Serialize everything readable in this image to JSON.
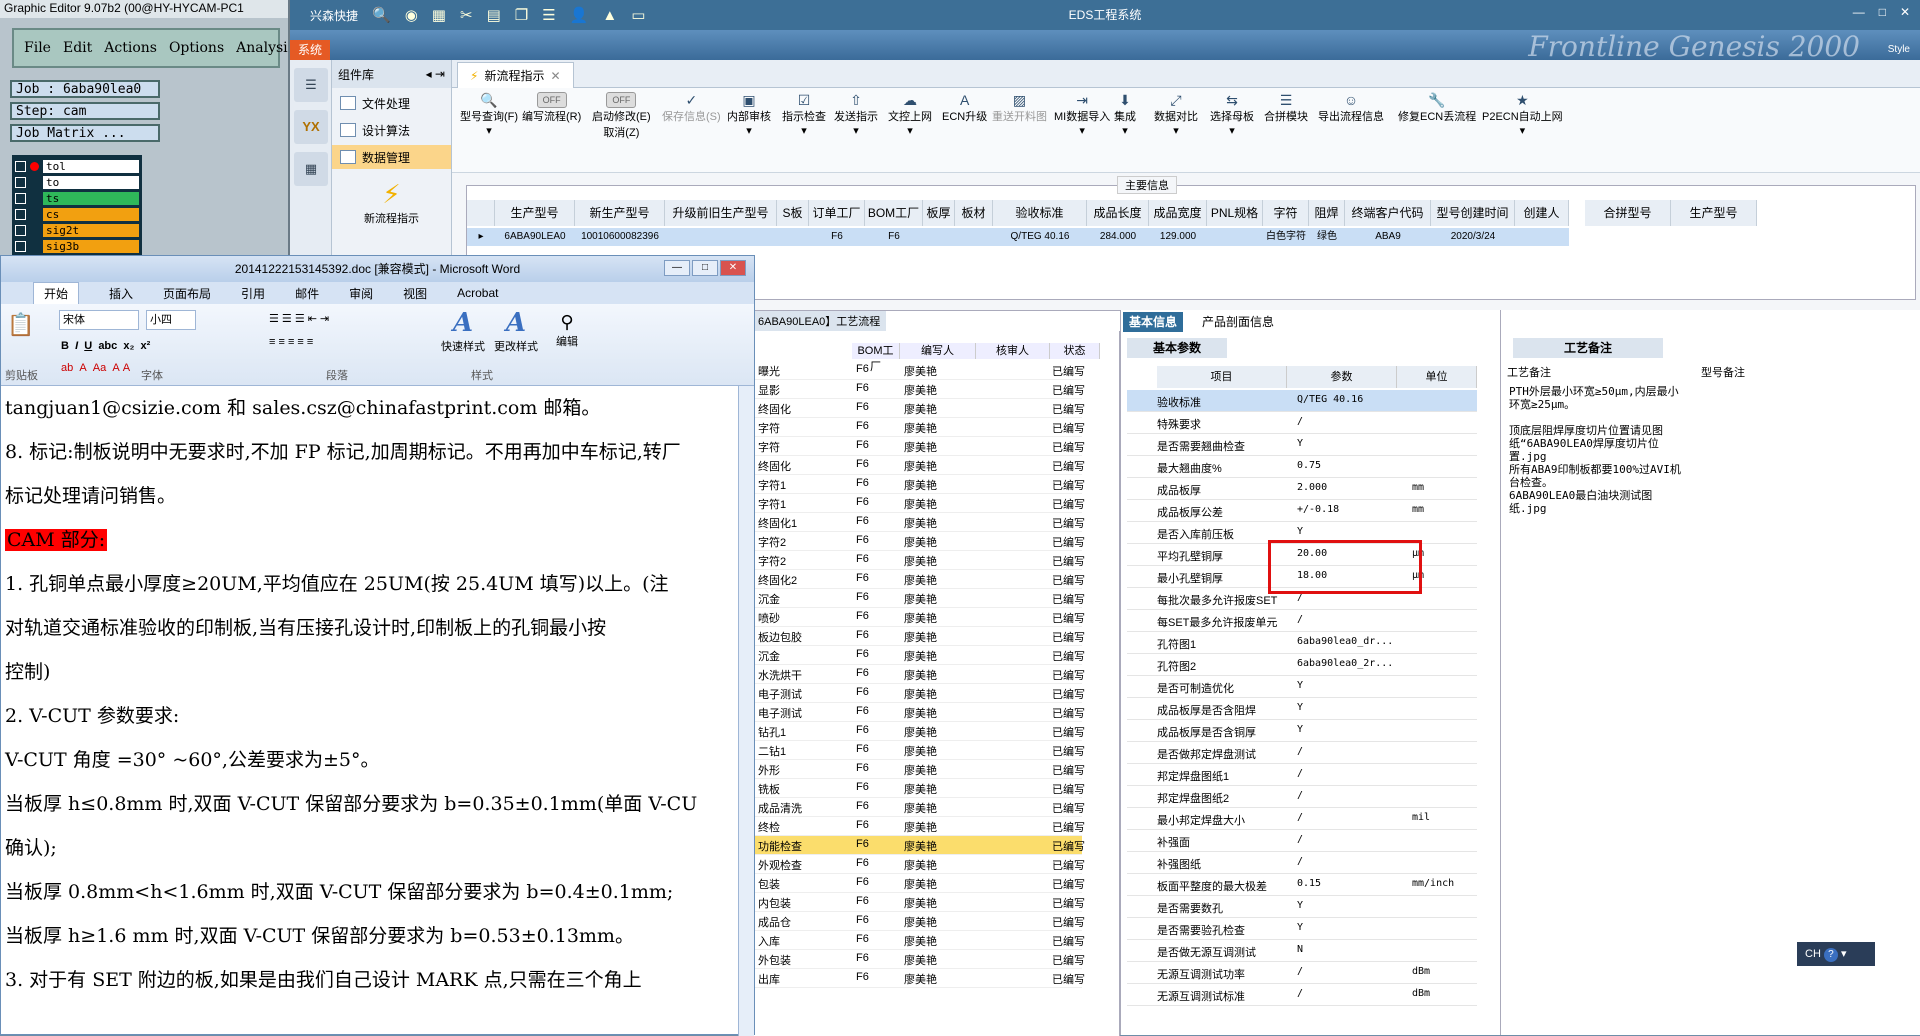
{
  "ge": {
    "title": "Graphic Editor 9.07b2 (00@HY-HYCAM-PC1",
    "menu": [
      "File",
      "Edit",
      "Actions",
      "Options",
      "Analysi"
    ],
    "job": "Job : 6aba90lea0",
    "step": "Step: cam",
    "matrix": "Job Matrix ...",
    "layers": [
      "tol",
      "to",
      "ts",
      "cs",
      "sig2t",
      "sig3b"
    ]
  },
  "eds": {
    "window_title": "EDS工程系统",
    "quick_label": "兴森快捷",
    "sys_btn": "系统",
    "banner": "Frontline Genesis 2000",
    "style_label": "Style",
    "nav": {
      "yx": "YX"
    },
    "comp_title": "组件库",
    "comp_items": [
      "文件处理",
      "设计算法",
      "数据管理"
    ],
    "new_flow_label": "新流程指示",
    "doc_tab": "新流程指示",
    "toolbar": {
      "query": "型号查询(F)",
      "toggle_off": "OFF",
      "edit_flow": "编写流程(R)",
      "start_mod": "启动修改(E)",
      "cancel": "取消(Z)",
      "buttons": [
        "保存信息(S)",
        "内部审核",
        "指示检查",
        "发送指示",
        "文控上网",
        "ECN升级",
        "重送开料图",
        "MI数据导入",
        "集成",
        "数据对比",
        "选择母板",
        "合拼模块",
        "导出流程信息",
        "修复ECN丢流程",
        "P2ECN自动上网"
      ]
    },
    "main_info_title": "主要信息",
    "table_headers": [
      "生产型号",
      "新生产型号",
      "升级前旧生产型号",
      "S板",
      "订单工厂",
      "BOM工厂",
      "板厚",
      "板材",
      "验收标准",
      "成品长度",
      "成品宽度",
      "PNL规格",
      "字符",
      "阻焊",
      "终端客户代码",
      "型号创建时间",
      "创建人",
      "合拼型号",
      "生产型号"
    ],
    "table_row": [
      "6ABA90LEA0",
      "10010600082396",
      "",
      "",
      "F6",
      "F6",
      "",
      "",
      "Q/TEG 40.16",
      "284.000",
      "129.000",
      "",
      "白色字符",
      "绿色",
      "ABA9",
      "2020/3/24",
      ""
    ],
    "process_tab": "6ABA90LEA0】工艺流程",
    "process_headers": [
      "BOM工厂",
      "编写人",
      "核审人",
      "状态"
    ],
    "process_rows": [
      {
        "step": "曝光",
        "bom": "F6",
        "writer": "廖美艳",
        "status": "已编写"
      },
      {
        "step": "显影",
        "bom": "F6",
        "writer": "廖美艳",
        "status": "已编写"
      },
      {
        "step": "终固化",
        "bom": "F6",
        "writer": "廖美艳",
        "status": "已编写"
      },
      {
        "step": "字符",
        "bom": "F6",
        "writer": "廖美艳",
        "status": "已编写"
      },
      {
        "step": "字符",
        "bom": "F6",
        "writer": "廖美艳",
        "status": "已编写"
      },
      {
        "step": "终固化",
        "bom": "F6",
        "writer": "廖美艳",
        "status": "已编写"
      },
      {
        "step": "字符1",
        "bom": "F6",
        "writer": "廖美艳",
        "status": "已编写"
      },
      {
        "step": "字符1",
        "bom": "F6",
        "writer": "廖美艳",
        "status": "已编写"
      },
      {
        "step": "终固化1",
        "bom": "F6",
        "writer": "廖美艳",
        "status": "已编写"
      },
      {
        "step": "字符2",
        "bom": "F6",
        "writer": "廖美艳",
        "status": "已编写"
      },
      {
        "step": "字符2",
        "bom": "F6",
        "writer": "廖美艳",
        "status": "已编写"
      },
      {
        "step": "终固化2",
        "bom": "F6",
        "writer": "廖美艳",
        "status": "已编写"
      },
      {
        "step": "沉金",
        "bom": "F6",
        "writer": "廖美艳",
        "status": "已编写"
      },
      {
        "step": "喷砂",
        "bom": "F6",
        "writer": "廖美艳",
        "status": "已编写"
      },
      {
        "step": "板边包胶",
        "bom": "F6",
        "writer": "廖美艳",
        "status": "已编写"
      },
      {
        "step": "沉金",
        "bom": "F6",
        "writer": "廖美艳",
        "status": "已编写"
      },
      {
        "step": "水洗烘干",
        "bom": "F6",
        "writer": "廖美艳",
        "status": "已编写"
      },
      {
        "step": "电子测试",
        "bom": "F6",
        "writer": "廖美艳",
        "status": "已编写"
      },
      {
        "step": "电子测试",
        "bom": "F6",
        "writer": "廖美艳",
        "status": "已编写"
      },
      {
        "step": "钻孔1",
        "bom": "F6",
        "writer": "廖美艳",
        "status": "已编写"
      },
      {
        "step": "二钻1",
        "bom": "F6",
        "writer": "廖美艳",
        "status": "已编写"
      },
      {
        "step": "外形",
        "bom": "F6",
        "writer": "廖美艳",
        "status": "已编写"
      },
      {
        "step": "铣板",
        "bom": "F6",
        "writer": "廖美艳",
        "status": "已编写"
      },
      {
        "step": "成品清洗",
        "bom": "F6",
        "writer": "廖美艳",
        "status": "已编写"
      },
      {
        "step": "终检",
        "bom": "F6",
        "writer": "廖美艳",
        "status": "已编写"
      },
      {
        "step": "功能检查",
        "bom": "F6",
        "writer": "廖美艳",
        "status": "已编写"
      },
      {
        "step": "外观检查",
        "bom": "F6",
        "writer": "廖美艳",
        "status": "已编写"
      },
      {
        "step": "包装",
        "bom": "F6",
        "writer": "廖美艳",
        "status": "已编写"
      },
      {
        "step": "内包装",
        "bom": "F6",
        "writer": "廖美艳",
        "status": "已编写"
      },
      {
        "step": "成品仓",
        "bom": "F6",
        "writer": "廖美艳",
        "status": "已编写"
      },
      {
        "step": "入库",
        "bom": "F6",
        "writer": "廖美艳",
        "status": "已编写"
      },
      {
        "step": "外包装",
        "bom": "F6",
        "writer": "廖美艳",
        "status": "已编写"
      },
      {
        "step": "出库",
        "bom": "F6",
        "writer": "廖美艳",
        "status": "已编写"
      }
    ],
    "basic_tabs": [
      "基本信息",
      "产品剖面信息"
    ],
    "basic_subtitle": "基本参数",
    "param_headers": [
      "项目",
      "参数",
      "单位"
    ],
    "params": [
      {
        "k": "验收标准",
        "v": "Q/TEG 40.16",
        "u": ""
      },
      {
        "k": "特殊要求",
        "v": "/",
        "u": ""
      },
      {
        "k": "是否需要翘曲检查",
        "v": "Y",
        "u": ""
      },
      {
        "k": "最大翘曲度%",
        "v": "0.75",
        "u": ""
      },
      {
        "k": "成品板厚",
        "v": "2.000",
        "u": "mm"
      },
      {
        "k": "成品板厚公差",
        "v": "+/-0.18",
        "u": "mm"
      },
      {
        "k": "是否入库前压板",
        "v": "Y",
        "u": ""
      },
      {
        "k": "平均孔壁铜厚",
        "v": "20.00",
        "u": "μm"
      },
      {
        "k": "最小孔壁铜厚",
        "v": "18.00",
        "u": "μm"
      },
      {
        "k": "每批次最多允许报废SET",
        "v": "/",
        "u": ""
      },
      {
        "k": "每SET最多允许报废单元",
        "v": "/",
        "u": ""
      },
      {
        "k": "孔符图1",
        "v": "6aba90lea0_dr...",
        "u": ""
      },
      {
        "k": "孔符图2",
        "v": "6aba90lea0_2r...",
        "u": ""
      },
      {
        "k": "是否可制造优化",
        "v": "Y",
        "u": ""
      },
      {
        "k": "成品板厚是否含阻焊",
        "v": "Y",
        "u": ""
      },
      {
        "k": "成品板厚是否含铜厚",
        "v": "Y",
        "u": ""
      },
      {
        "k": "是否做邦定焊盘测试",
        "v": "/",
        "u": ""
      },
      {
        "k": "邦定焊盘图纸1",
        "v": "/",
        "u": ""
      },
      {
        "k": "邦定焊盘图纸2",
        "v": "/",
        "u": ""
      },
      {
        "k": "最小邦定焊盘大小",
        "v": "/",
        "u": "mil"
      },
      {
        "k": "补强面",
        "v": "/",
        "u": ""
      },
      {
        "k": "补强图纸",
        "v": "/",
        "u": ""
      },
      {
        "k": "板面平整度的最大极差",
        "v": "0.15",
        "u": "mm/inch"
      },
      {
        "k": "是否需要数孔",
        "v": "Y",
        "u": ""
      },
      {
        "k": "是否需要验孔检查",
        "v": "Y",
        "u": ""
      },
      {
        "k": "是否做无源互调测试",
        "v": "N",
        "u": ""
      },
      {
        "k": "无源互调测试功率",
        "v": "/",
        "u": "dBm"
      },
      {
        "k": "无源互调测试标准",
        "v": "/",
        "u": "dBm"
      }
    ],
    "gy_tab": "工艺备注",
    "gy_col1": "工艺备注",
    "gy_col2": "型号备注",
    "gy_note": "PTH外层最小环宽≥50μm,内层最小环宽≥25μm。\n\n顶底层阻焊厚度切片位置请见图纸“6ABA90LEA0焊厚度切片位置.jpg\n所有ABA9印制板都要100%过AVI机台检查。\n6ABA90LEA0最白油块测试图纸.jpg"
  },
  "word": {
    "title": "20141222153145392.doc [兼容模式] - Microsoft Word",
    "tabs": [
      "开始",
      "插入",
      "页面布局",
      "引用",
      "邮件",
      "审阅",
      "视图",
      "Acrobat"
    ],
    "font": "宋体",
    "size": "小四",
    "groups": [
      "剪贴板",
      "字体",
      "段落",
      "样式",
      "编辑"
    ],
    "quick_style": "快速样式",
    "change_style": "更改样式",
    "edit": "编辑",
    "lines": [
      "tangjuan1@csizie.com 和 sales.csz@chinafastprint.com 邮箱。",
      "8.  标记:制板说明中无要求时,不加 FP 标记,加周期标记。不用再加中车标记,转厂",
      "标记处理请问销售。",
      "",
      "CAM 部分:",
      "1.  孔铜单点最小厚度≥20UM,平均值应在 25UM(按 25.4UM 填写)以上。(注",
      "对轨道交通标准验收的印制板,当有压接孔设计时,印制板上的孔铜最小按",
      "控制)",
      "2.  V-CUT 参数要求:",
      "V-CUT 角度 =30° ~60°,公差要求为±5°。",
      "当板厚 h≤0.8mm 时,双面 V-CUT 保留部分要求为 b=0.35±0.1mm(单面 V-CU",
      "确认);",
      "当板厚 0.8mm<h<1.6mm 时,双面 V-CUT 保留部分要求为 b=0.4±0.1mm;",
      "当板厚 h≥1.6 mm 时,双面 V-CUT 保留部分要求为 b=0.53±0.13mm。",
      "3.  对于有 SET 附边的板,如果是由我们自己设计 MARK 点,只需在三个角上"
    ]
  },
  "taskbar": {
    "lang": "CH"
  }
}
